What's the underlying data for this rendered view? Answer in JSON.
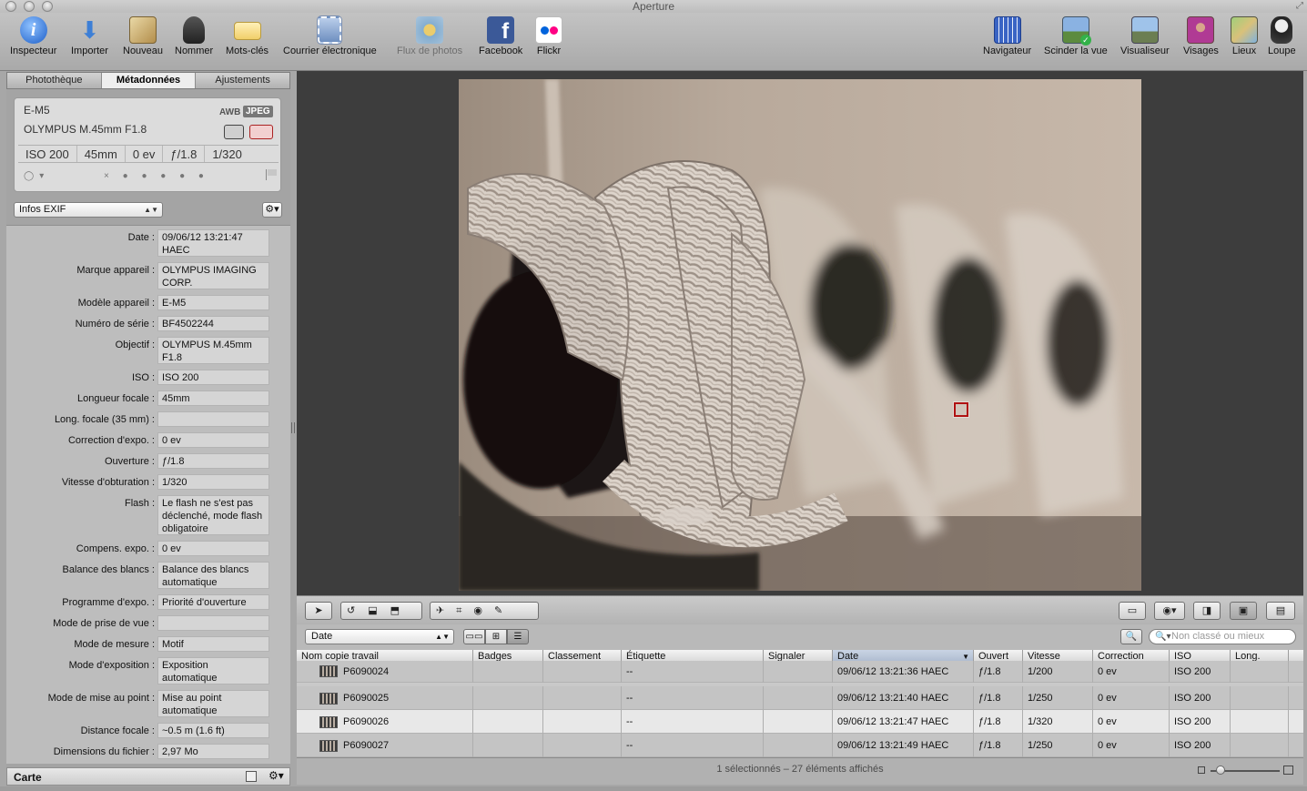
{
  "app": {
    "title": "Aperture"
  },
  "toolbar": {
    "left": [
      {
        "label": "Inspecteur",
        "icon": "info-icon"
      },
      {
        "label": "Importer",
        "icon": "import-arrow-icon"
      },
      {
        "label": "Nouveau",
        "icon": "new-album-icon"
      },
      {
        "label": "Nommer",
        "icon": "person-name-icon"
      },
      {
        "label": "Mots-clés",
        "icon": "keyword-tag-icon"
      },
      {
        "label": "Courrier électronique",
        "icon": "email-stamp-icon"
      },
      {
        "label": "Flux de photos",
        "icon": "photostream-icon"
      },
      {
        "label": "Facebook",
        "icon": "facebook-icon"
      },
      {
        "label": "Flickr",
        "icon": "flickr-icon"
      }
    ],
    "right": [
      {
        "label": "Navigateur",
        "icon": "browser-grid-icon"
      },
      {
        "label": "Scinder la vue",
        "icon": "split-view-icon"
      },
      {
        "label": "Visualiseur",
        "icon": "viewer-icon"
      },
      {
        "label": "Visages",
        "icon": "faces-icon"
      },
      {
        "label": "Lieux",
        "icon": "places-icon"
      },
      {
        "label": "Loupe",
        "icon": "loupe-icon"
      }
    ]
  },
  "inspector": {
    "tabs": [
      {
        "label": "Photothèque",
        "active": false
      },
      {
        "label": "Métadonnées",
        "active": true
      },
      {
        "label": "Ajustements",
        "active": false
      }
    ],
    "camera": {
      "model": "E-M5",
      "lens": "OLYMPUS M.45mm F1.8",
      "wb": "AWB",
      "format": "JPEG",
      "iso": "ISO 200",
      "focal": "45mm",
      "exposure": "0 ev",
      "aperture": "ƒ/1.8",
      "shutter": "1/320",
      "rating_reject": "×"
    },
    "preset": "Infos EXIF",
    "fields": [
      {
        "key": "Date :",
        "value": "09/06/12 13:21:47 HAEC"
      },
      {
        "key": "Marque appareil :",
        "value": "OLYMPUS IMAGING CORP."
      },
      {
        "key": "Modèle appareil :",
        "value": "E-M5"
      },
      {
        "key": "Numéro de série :",
        "value": "BF4502244"
      },
      {
        "key": "Objectif :",
        "value": "OLYMPUS M.45mm F1.8"
      },
      {
        "key": "ISO :",
        "value": "ISO 200"
      },
      {
        "key": "Longueur focale :",
        "value": "45mm"
      },
      {
        "key": "Long. focale (35 mm) :",
        "value": ""
      },
      {
        "key": "Correction d'expo. :",
        "value": "0 ev"
      },
      {
        "key": "Ouverture :",
        "value": "ƒ/1.8"
      },
      {
        "key": "Vitesse d'obturation :",
        "value": "1/320"
      },
      {
        "key": "Flash :",
        "value": "Le flash ne s'est pas déclenché, mode flash obligatoire"
      },
      {
        "key": "Compens. expo. :",
        "value": "0 ev"
      },
      {
        "key": "Balance des blancs :",
        "value": "Balance des blancs automatique"
      },
      {
        "key": "Programme d'expo. :",
        "value": "Priorité d'ouverture"
      },
      {
        "key": "Mode de prise de vue :",
        "value": ""
      },
      {
        "key": "Mode de mesure :",
        "value": "Motif"
      },
      {
        "key": "Mode d'exposition :",
        "value": "Exposition automatique"
      },
      {
        "key": "Mode de mise au point :",
        "value": "Mise au point automatique"
      },
      {
        "key": "Distance focale :",
        "value": "~0.5 m (1.6 ft)"
      },
      {
        "key": "Dimensions du fichier :",
        "value": "2,97 Mo"
      }
    ],
    "footer": {
      "label": "Carte"
    }
  },
  "browser": {
    "sort": "Date",
    "search_placeholder": "Non classé ou mieux",
    "columns": [
      "Nom copie travail",
      "Badges",
      "Classement",
      "Étiquette",
      "Signaler",
      "Date",
      "Ouvert",
      "Vitesse",
      "Correction",
      "ISO",
      "Long."
    ],
    "rows": [
      {
        "name": "P6090024",
        "badges": "",
        "rating": "",
        "label": "--",
        "flag": "",
        "date": "09/06/12 13:21:36 HAEC",
        "aperture": "ƒ/1.8",
        "shutter": "1/200",
        "correction": "0 ev",
        "iso": "ISO 200",
        "focal": "",
        "selected": false
      },
      {
        "name": "P6090025",
        "badges": "",
        "rating": "",
        "label": "--",
        "flag": "",
        "date": "09/06/12 13:21:40 HAEC",
        "aperture": "ƒ/1.8",
        "shutter": "1/250",
        "correction": "0 ev",
        "iso": "ISO 200",
        "focal": "",
        "selected": false
      },
      {
        "name": "P6090026",
        "badges": "",
        "rating": "",
        "label": "--",
        "flag": "",
        "date": "09/06/12 13:21:47 HAEC",
        "aperture": "ƒ/1.8",
        "shutter": "1/320",
        "correction": "0 ev",
        "iso": "ISO 200",
        "focal": "",
        "selected": true
      },
      {
        "name": "P6090027",
        "badges": "",
        "rating": "",
        "label": "--",
        "flag": "",
        "date": "09/06/12 13:21:49 HAEC",
        "aperture": "ƒ/1.8",
        "shutter": "1/250",
        "correction": "0 ev",
        "iso": "ISO 200",
        "focal": "",
        "selected": false
      }
    ],
    "status": "1 sélectionnés – 27 éléments affichés"
  }
}
